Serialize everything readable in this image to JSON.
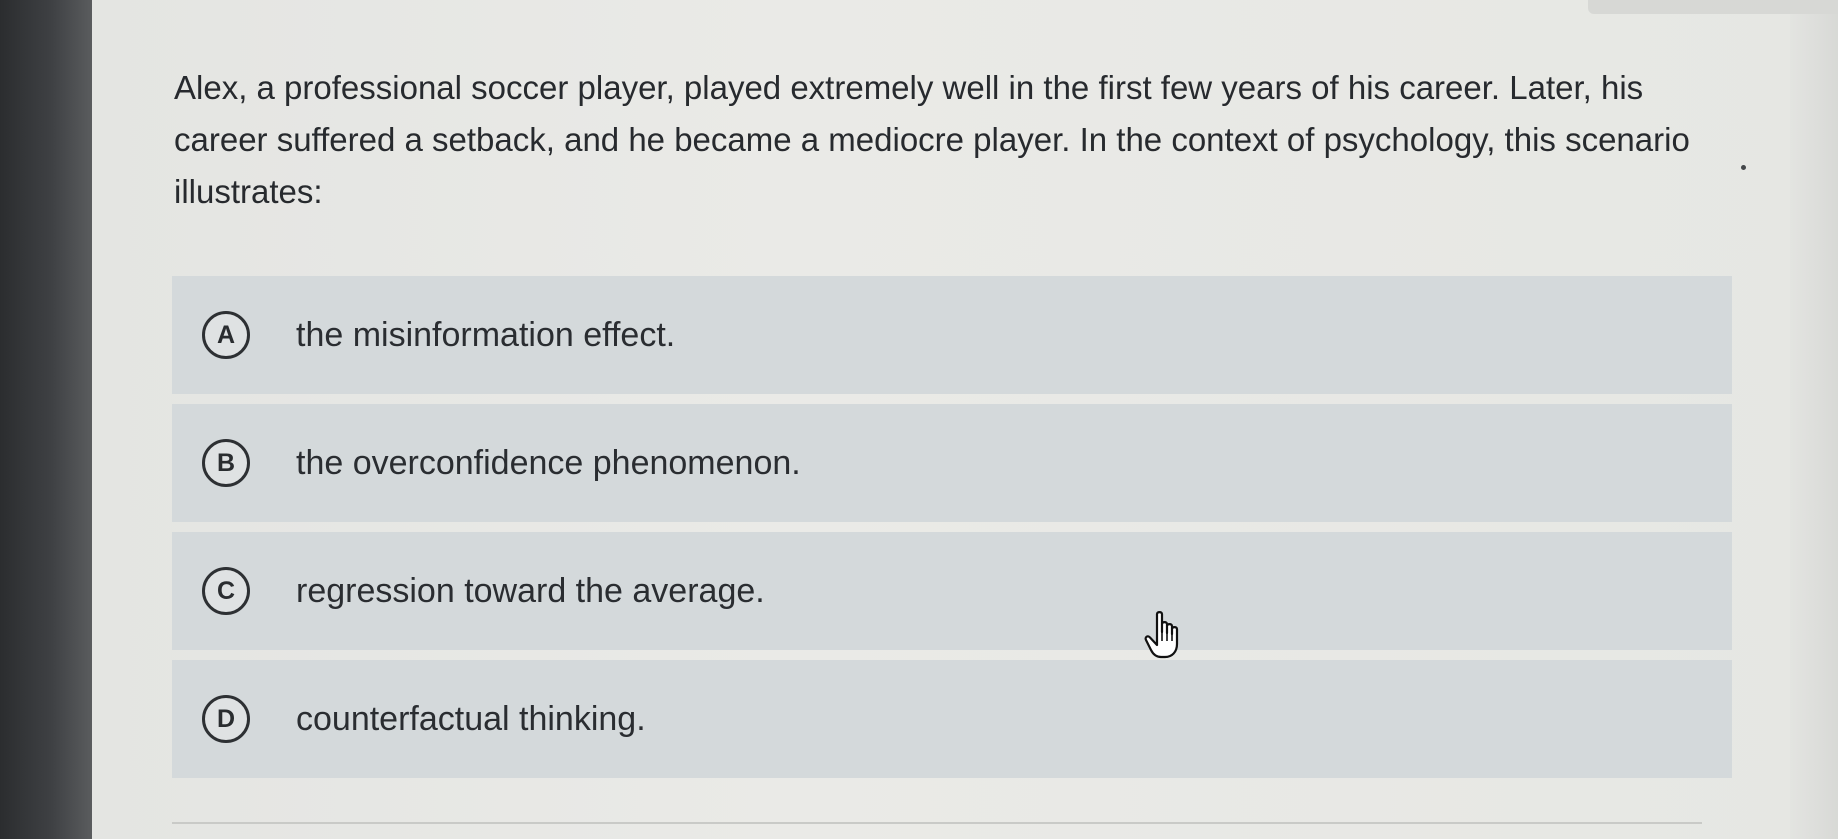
{
  "question": {
    "text": "Alex, a professional soccer player, played extremely well in the first few years of his career. Later, his career suffered a setback, and he became a mediocre player. In the context of psychology, this scenario illustrates:"
  },
  "options": [
    {
      "letter": "A",
      "text": "the misinformation effect."
    },
    {
      "letter": "B",
      "text": "the overconfidence phenomenon."
    },
    {
      "letter": "C",
      "text": "regression toward the average."
    },
    {
      "letter": "D",
      "text": "counterfactual thinking."
    }
  ],
  "icons": {
    "cursor": "hand-pointer-icon"
  },
  "colors": {
    "option_background": "#d4d9db",
    "page_background": "#e8e8e5",
    "text": "#272a2e"
  }
}
